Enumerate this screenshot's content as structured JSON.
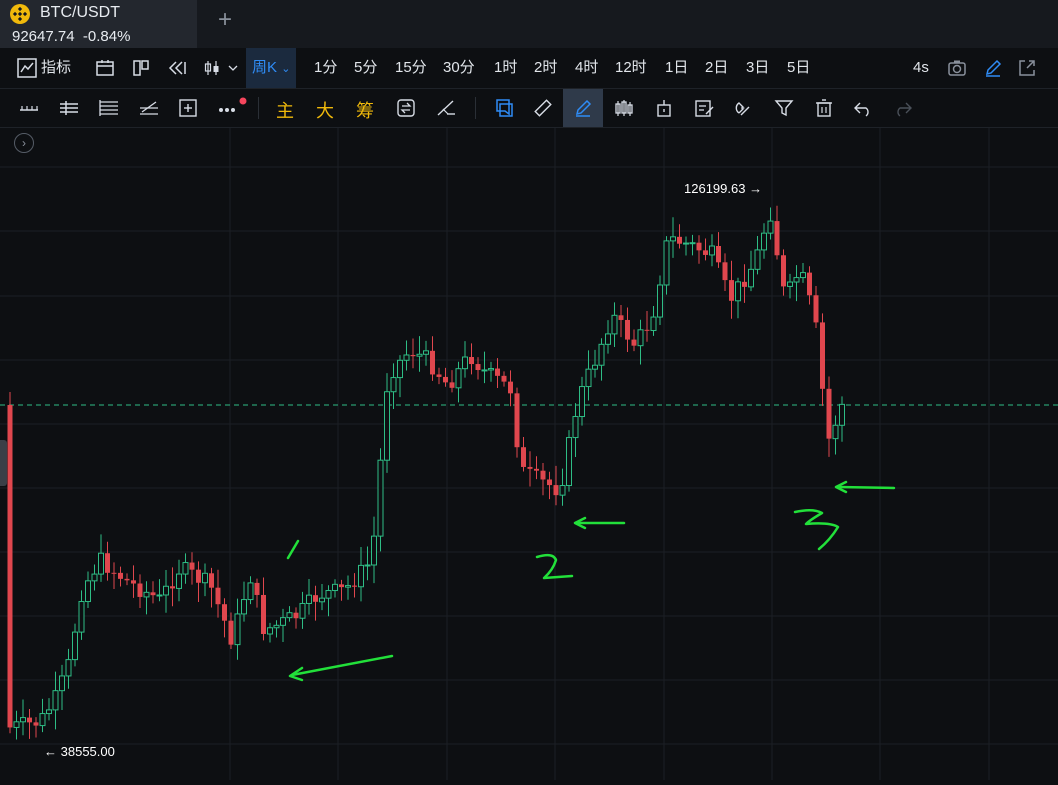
{
  "tab": {
    "pair": "BTC/USDT",
    "price": "92647.74",
    "change": "-0.84%"
  },
  "toolbar1": {
    "indicators_label": "指标",
    "intervals": [
      "周K",
      "1分",
      "5分",
      "15分",
      "30分",
      "1时",
      "2时",
      "4时",
      "12时",
      "1日",
      "2日",
      "3日",
      "5日"
    ],
    "selected_interval": "周K",
    "refresh": "4s"
  },
  "toolbar2": {
    "main_label": "主",
    "big_label": "大",
    "chip_label": "筹"
  },
  "chart": {
    "high_label": "126199.63",
    "low_label": "38555.00",
    "annotations": [
      "1",
      "2",
      "3"
    ],
    "colors": {
      "up": "#2ebd85",
      "down": "#e0474e",
      "annotation": "#22e03a",
      "current_price_line": "#2ebd85"
    }
  },
  "chart_data": {
    "type": "candlestick",
    "symbol": "BTC/USDT",
    "interval": "周K",
    "marked_high": 126199.63,
    "marked_low": 38555.0,
    "current_price": 92647.74
  }
}
